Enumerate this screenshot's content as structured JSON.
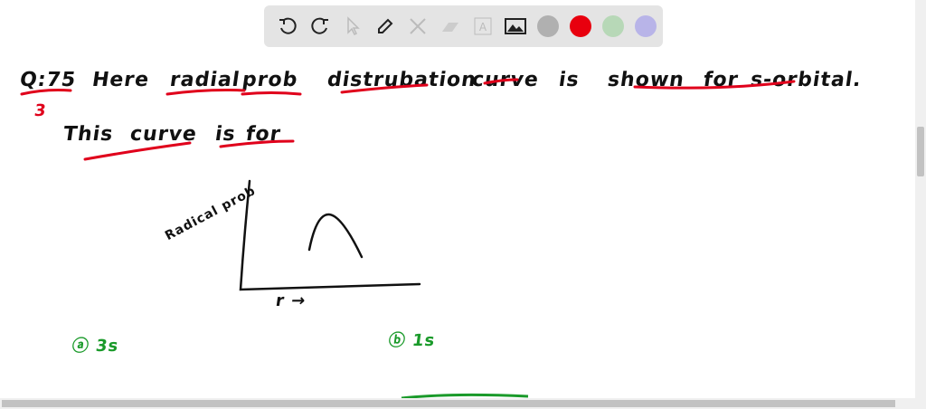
{
  "toolbar": {
    "tools": [
      "undo-icon",
      "redo-icon",
      "select-icon",
      "pen-icon",
      "tools-icon",
      "eraser-icon",
      "text-icon",
      "image-icon"
    ],
    "colors": [
      "#b0b0b0",
      "#e8000e",
      "#b7d8b7",
      "#b8b4e8"
    ]
  },
  "board": {
    "question_number": "Q:75",
    "marker": "3",
    "words": [
      "Here",
      "radial",
      "prob",
      "distrubation",
      "curve",
      "is",
      "shown",
      "for",
      "s-orbital."
    ],
    "line2": [
      "This",
      "curve",
      "is",
      "for"
    ],
    "y_label": "Radical prob",
    "x_label": "r →",
    "option_a": "ⓐ 3s",
    "option_b": "ⓑ 1s"
  }
}
